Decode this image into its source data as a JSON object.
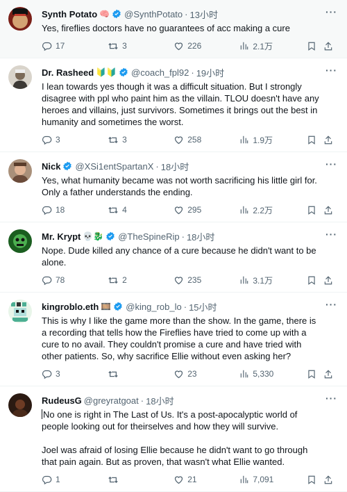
{
  "tweets": [
    {
      "name": "Synth Potato",
      "emoji": "🧠",
      "handle": "@SynthPotato",
      "time": "13小时",
      "paragraphs": [
        "Yes, fireflies doctors have no guarantees of acc making a cure"
      ],
      "replies": "17",
      "retweets": "3",
      "likes": "226",
      "views": "2.1万",
      "avatar_color": "#c0392b"
    },
    {
      "name": "Dr. Rasheed",
      "emoji": "🔰🔰",
      "handle": "@coach_fpl92",
      "time": "19小时",
      "paragraphs": [
        "I lean towards yes though it was a difficult situation. But I strongly disagree with ppl who paint him as the villain. TLOU doesn't have any heroes and villains, just survivors. Sometimes it brings out the best in humanity and sometimes the worst."
      ],
      "replies": "3",
      "retweets": "3",
      "likes": "258",
      "views": "1.9万",
      "avatar_color": "#b9b2a5"
    },
    {
      "name": "Nick",
      "emoji": "",
      "handle": "@XSi1entSpartanX",
      "time": "18小时",
      "paragraphs": [
        "Yes, what humanity became was not worth sacrificing his little girl for. Only a father understands the ending."
      ],
      "replies": "18",
      "retweets": "4",
      "likes": "295",
      "views": "2.2万",
      "avatar_color": "#8a6f5a"
    },
    {
      "name": "Mr. Krypt",
      "emoji": "💀🐉",
      "handle": "@TheSpineRip",
      "time": "18小时",
      "paragraphs": [
        "Nope. Dude killed any chance of a cure because he didn't want to be alone."
      ],
      "replies": "78",
      "retweets": "2",
      "likes": "235",
      "views": "3.1万",
      "avatar_color": "#2e7d32"
    },
    {
      "name": "kingroblo.eth",
      "emoji": "🎞️",
      "handle": "@king_rob_lo",
      "time": "15小时",
      "paragraphs": [
        "This is why I like the game more than the show. In the game, there is a recording that tells how the Fireflies have tried to come up with a cure to no avail. They couldn't promise a cure and have tried with other patients. So, why sacrifice Ellie without even asking her?"
      ],
      "replies": "3",
      "retweets": "",
      "likes": "23",
      "views": "5,330",
      "avatar_color": "#4caf93"
    },
    {
      "name": "RudeusG",
      "emoji": "",
      "handle": "@greyratgoat",
      "time": "18小时",
      "paragraphs": [
        "No one is right in The Last of Us. It's a post-apocalyptic world of people looking out for theirselves and how they will survive.",
        "Joel was afraid of losing Ellie because he didn't want to go through that pain again. But as proven, that wasn't what Ellie wanted."
      ],
      "replies": "1",
      "retweets": "",
      "likes": "21",
      "views": "7,091",
      "avatar_color": "#3a2418"
    }
  ],
  "colors": {
    "verified": "#1d9bf0",
    "muted": "#536471",
    "text": "#0f1419"
  },
  "icons": [
    "reply-icon",
    "retweet-icon",
    "like-icon",
    "views-icon",
    "bookmark-icon",
    "share-icon",
    "more-icon",
    "verified-badge-icon"
  ]
}
